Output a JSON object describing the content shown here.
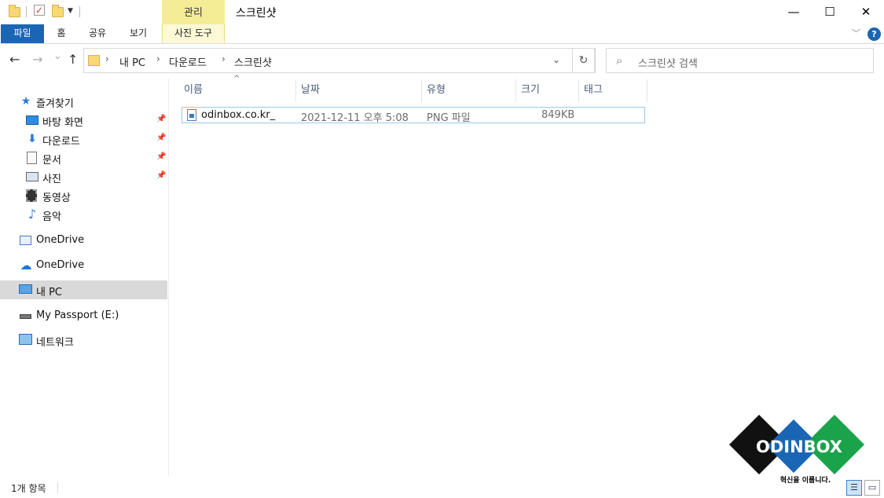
{
  "window": {
    "title": "스크린샷",
    "contextual_tab_header": "관리",
    "controls": {
      "minimize": "—",
      "maximize": "☐",
      "close": "✕"
    }
  },
  "ribbon": {
    "tabs": [
      "파일",
      "홈",
      "공유",
      "보기"
    ],
    "contextual_tab": "사진 도구",
    "help": "?",
    "expand": "﹀"
  },
  "nav": {
    "back": "←",
    "forward": "→",
    "recent": "⌄",
    "up": "↑",
    "path": [
      "내 PC",
      "다운로드",
      "스크린샷"
    ],
    "refresh": "↻",
    "search_placeholder": "스크린샷 검색"
  },
  "sidebar": {
    "quick_access": "즐겨찾기",
    "pinned": [
      "바탕 화면",
      "다운로드",
      "문서",
      "사진"
    ],
    "unpinned": [
      "동영상",
      "음악"
    ],
    "onedrive_1": "OneDrive",
    "onedrive_2": "OneDrive",
    "this_pc": "내 PC",
    "drive": "My Passport (E:)",
    "network": "네트워크"
  },
  "columns": [
    "이름",
    "날짜",
    "유형",
    "크기",
    "태그"
  ],
  "files": [
    {
      "name": "odinbox.co.kr_",
      "date": "2021-12-11 오후 5:08",
      "type": "PNG 파일",
      "size": "849KB"
    }
  ],
  "status": {
    "item_count": "1개 항목"
  },
  "logo": {
    "brand": "ODINBOX",
    "tagline": "혁신을 이룹니다."
  },
  "colors": {
    "file_tab": "#1a66b5",
    "manage_tab": "#f5ec96",
    "logo_black": "#111111",
    "logo_blue": "#1a66b5",
    "logo_green": "#1aa34a"
  }
}
